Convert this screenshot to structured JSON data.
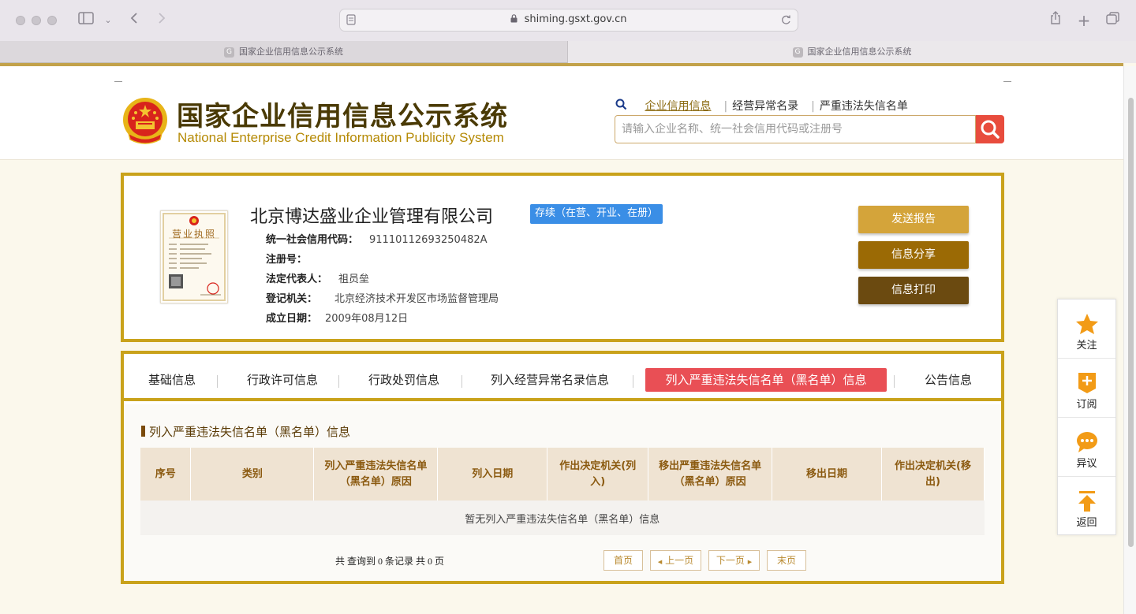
{
  "browser": {
    "url": "shiming.gsxt.gov.cn",
    "tabs": [
      {
        "title": "国家企业信用信息公示系统",
        "favicon": "G"
      },
      {
        "title": "国家企业信用信息公示系统",
        "favicon": "G"
      }
    ]
  },
  "header": {
    "logo_cn": "国家企业信用信息公示系统",
    "logo_en": "National Enterprise Credit Information Publicity System",
    "search_tabs": [
      "企业信用信息",
      "经营异常名录",
      "严重违法失信名单"
    ],
    "search_placeholder": "请输入企业名称、统一社会信用代码或注册号"
  },
  "company": {
    "name": "北京博达盛业企业管理有限公司",
    "status": "存续（在营、开业、在册）",
    "license_title": "营业执照",
    "fields": [
      {
        "label": "统一社会信用代码：",
        "value": "91110112693250482A"
      },
      {
        "label": "注册号：",
        "value": ""
      },
      {
        "label": "法定代表人：",
        "value": "祖员垒"
      },
      {
        "label": "登记机关：",
        "value": "北京经济技术开发区市场监督管理局"
      },
      {
        "label": "成立日期：",
        "value": "2009年08月12日"
      }
    ],
    "actions": [
      {
        "label": "发送报告",
        "color": "#d4a43a"
      },
      {
        "label": "信息分享",
        "color": "#9b6a05"
      },
      {
        "label": "信息打印",
        "color": "#6b4a10"
      }
    ]
  },
  "info_tabs": [
    "基础信息",
    "行政许可信息",
    "行政处罚信息",
    "列入经营异常名录信息",
    "列入严重违法失信名单（黑名单）信息",
    "公告信息"
  ],
  "active_tab": "列入严重违法失信名单（黑名单）信息",
  "section": {
    "title": "列入严重违法失信名单（黑名单）信息",
    "columns": [
      "序号",
      "类别",
      "列入严重违法失信名单（黑名单）原因",
      "列入日期",
      "作出决定机关(列入)",
      "移出严重违法失信名单（黑名单）原因",
      "移出日期",
      "作出决定机关(移出)"
    ],
    "empty_text": "暂无列入严重违法失信名单（黑名单）信息",
    "pager_info": "共 查询到 0 条记录 共 0 页",
    "pager_buttons": [
      "首页",
      "上一页",
      "下一页",
      "末页"
    ]
  },
  "side_widget": [
    {
      "label": "关注",
      "icon": "star-icon"
    },
    {
      "label": "订阅",
      "icon": "subscribe-icon"
    },
    {
      "label": "异议",
      "icon": "chat-icon"
    },
    {
      "label": "返回",
      "icon": "back-to-top-icon"
    }
  ],
  "colors": {
    "gold": "#c9a21b",
    "active_tab": "#e94f55",
    "status": "#3a8ee6",
    "search_button": "#e84c3d"
  }
}
